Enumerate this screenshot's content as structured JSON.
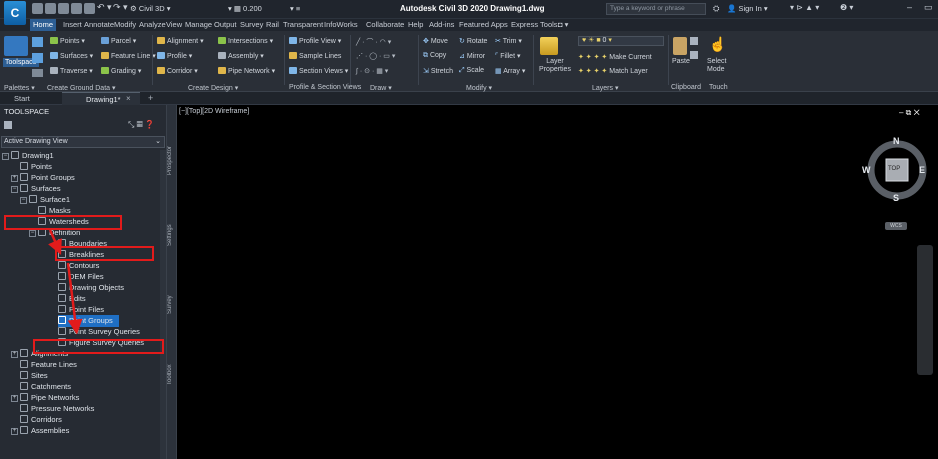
{
  "titlebar": {
    "logo": "C",
    "app_title": "Autodesk Civil 3D 2020   Drawing1.dwg",
    "workspace": "Civil 3D",
    "input_value": "0.200",
    "search_placeholder": "Type a keyword or phrase",
    "sign_in": "Sign In"
  },
  "tabs": [
    "Home",
    "Insert",
    "Annotate",
    "Modify",
    "Analyze",
    "View",
    "Manage",
    "Output",
    "Survey",
    "Rail",
    "Transparent",
    "InfoWorks",
    "Collaborate",
    "Help",
    "Add-ins",
    "Featured Apps",
    "Express Tools"
  ],
  "ribbon": {
    "toolspace": "Toolspace",
    "ground_data": [
      "Points ▾",
      "Surfaces ▾",
      "Traverse ▾",
      "Parcel ▾",
      "Feature Line ▾",
      "Grading ▾"
    ],
    "design": [
      "Alignment ▾",
      "Profile ▾",
      "Corridor ▾",
      "Intersections ▾",
      "Assembly ▾",
      "Pipe Network ▾"
    ],
    "profile": [
      "Profile View ▾",
      "Sample Lines",
      "Section Views ▾"
    ],
    "modify": [
      "Move",
      "Rotate",
      "Trim ▾",
      "Copy",
      "Mirror",
      "Fillet ▾",
      "Stretch",
      "Scale",
      "Array ▾"
    ],
    "layers": [
      "Layer Properties",
      "Make Current",
      "Match Layer"
    ],
    "layer_value": "0",
    "clipboard": "Paste",
    "touch": "Select Mode",
    "panels": [
      "Palettes ▾",
      "Create Ground Data ▾",
      "Create Design ▾",
      "Profile & Section Views",
      "Draw ▾",
      "Modify ▾",
      "Layers ▾",
      "Clipboard",
      "Touch"
    ]
  },
  "doctabs": {
    "start": "Start",
    "drawing": "Drawing1*"
  },
  "toolspace": {
    "title": "TOOLSPACE",
    "view_select": "Active Drawing View",
    "tree": [
      "Drawing1",
      "Points",
      "Point Groups",
      "Surfaces",
      "Surface1",
      "Masks",
      "Watersheds",
      "Definition",
      "Boundaries",
      "Breaklines",
      "Contours",
      "DEM Files",
      "Drawing Objects",
      "Edits",
      "Point Files",
      "Point Groups",
      "Point Survey Queries",
      "Figure Survey Queries",
      "Alignments",
      "Feature Lines",
      "Sites",
      "Catchments",
      "Pipe Networks",
      "Pressure Networks",
      "Corridors",
      "Assemblies"
    ],
    "strip_tabs": [
      "Prospector",
      "Settings",
      "Survey",
      "Toolbox"
    ]
  },
  "viewport": {
    "label": "[−][Top][2D Wireframe]",
    "compass": {
      "n": "N",
      "s": "S",
      "e": "E",
      "w": "W",
      "top": "TOP",
      "wcs": "WCS"
    }
  },
  "colors": {
    "accent": "#2d5e93",
    "annotation": "#e21b1b",
    "selection": "#1f6fc4"
  }
}
